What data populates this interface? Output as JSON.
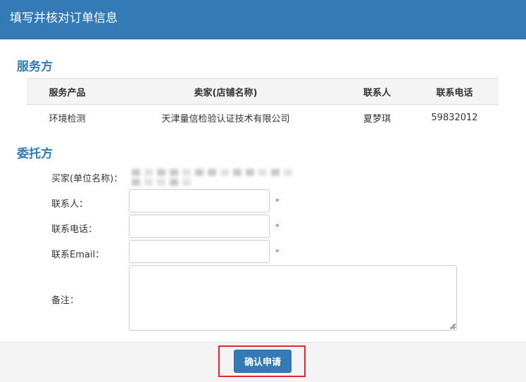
{
  "dialog": {
    "title": "填写并核对订单信息"
  },
  "service": {
    "section_title": "服务方",
    "columns": [
      "服务产品",
      "卖家(店铺名称)",
      "联系人",
      "联系电话"
    ],
    "rows": [
      [
        "环境检测",
        "天津量信检验认证技术有限公司",
        "夏梦琪",
        "59832012"
      ]
    ]
  },
  "client": {
    "section_title": "委托方",
    "buyer_label": "买家(单位名称)：",
    "contact_label": "联系人：",
    "phone_label": "联系电话：",
    "email_label": "联系Email：",
    "notes_label": "备注：",
    "required_mark": "*",
    "contact_value": "",
    "phone_value": "",
    "email_value": "",
    "notes_value": ""
  },
  "footer": {
    "submit_label": "确认申请"
  },
  "colors": {
    "header_bg": "#337ab7",
    "section_title": "#2f7bb8",
    "required": "#d9302c",
    "highlight": "#e5252a"
  }
}
